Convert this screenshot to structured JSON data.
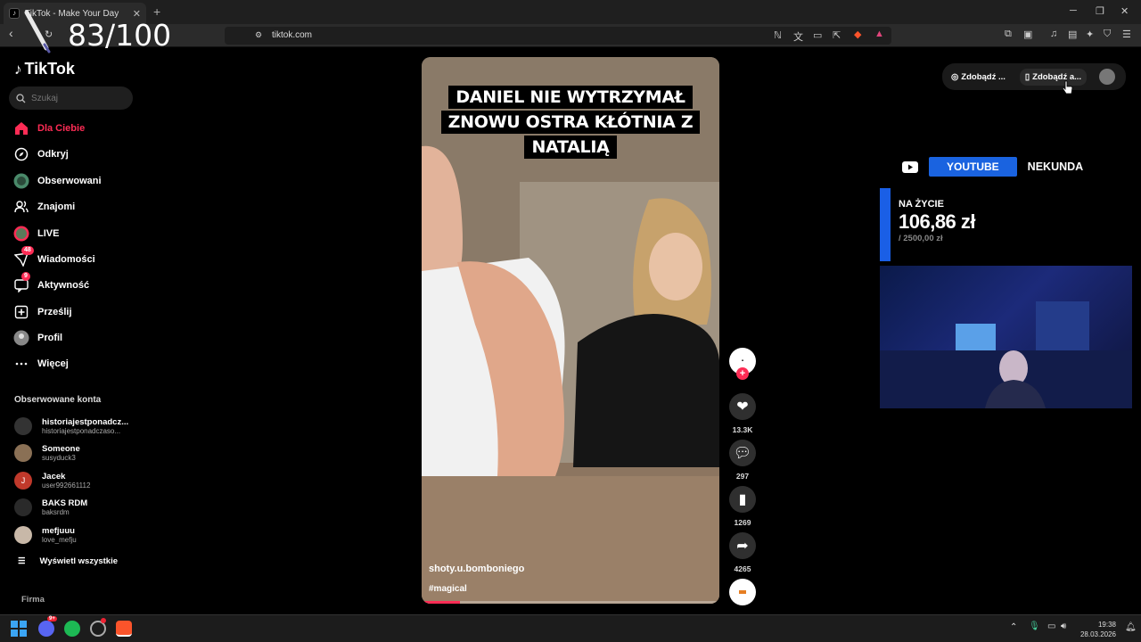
{
  "browser": {
    "tab_title": "TikTok - Make Your Day",
    "url": "tiktok.com"
  },
  "overlay_score": "83/100",
  "sidebar": {
    "logo": "TikTok",
    "search_placeholder": "Szukaj",
    "nav": [
      {
        "label": "Dla Ciebie",
        "icon": "home-icon",
        "active": true,
        "badge": ""
      },
      {
        "label": "Odkryj",
        "icon": "compass-icon",
        "active": false,
        "badge": ""
      },
      {
        "label": "Obserwowani",
        "icon": "following-avatar-icon",
        "active": false,
        "badge": ""
      },
      {
        "label": "Znajomi",
        "icon": "friends-icon",
        "active": false,
        "badge": ""
      },
      {
        "label": "LIVE",
        "icon": "live-icon",
        "active": false,
        "badge": ""
      },
      {
        "label": "Wiadomości",
        "icon": "messages-icon",
        "active": false,
        "badge": "48"
      },
      {
        "label": "Aktywność",
        "icon": "activity-icon",
        "active": false,
        "badge": "9"
      },
      {
        "label": "Prześlij",
        "icon": "upload-icon",
        "active": false,
        "badge": ""
      },
      {
        "label": "Profil",
        "icon": "profile-icon",
        "active": false,
        "badge": ""
      },
      {
        "label": "Więcej",
        "icon": "more-icon",
        "active": false,
        "badge": ""
      }
    ],
    "followed_header": "Obserwowane konta",
    "followed": [
      {
        "name": "historiajestponadcz...",
        "handle": "historiajestponadczaso...",
        "color": "#333333"
      },
      {
        "name": "Someone",
        "handle": "susyduck3",
        "color": "#8a7055"
      },
      {
        "name": "Jacek",
        "handle": "user992661112",
        "color": "#c0392b",
        "initial": "J"
      },
      {
        "name": "BAKS RDM",
        "handle": "baksrdm",
        "color": "#2a2a2a"
      },
      {
        "name": "mefjuuu",
        "handle": "love_mefju",
        "color": "#c8b8a8"
      }
    ],
    "show_all": "Wyświetl wszystkie",
    "footer": "Firma"
  },
  "video": {
    "caption_lines": [
      "DANIEL NIE WYTRZYMAŁ",
      "ZNOWU OSTRA KŁÓTNIA Z",
      "NATALIĄ"
    ],
    "author": "shoty.u.bomboniego",
    "hashtag": "#magical",
    "progress": 0.13
  },
  "actions": {
    "likes": "13.3K",
    "comments": "297",
    "saves": "1269",
    "shares": "4265"
  },
  "top_right": {
    "btn1": "Zdobądź ...",
    "btn2": "Zdobądź a..."
  },
  "stream_overlay": {
    "youtube_label": "YOUTUBE",
    "nekunda_label": "NEKUNDA",
    "goal_label": "NA ŻYCIE",
    "goal_amount": "106,86 zł",
    "goal_target": "/ 2500,00 zł"
  },
  "taskbar": {
    "time": "19:38",
    "date": "28.03.2026",
    "discord_badge": "9+"
  },
  "colors": {
    "accent": "#fe2c55",
    "youtube_blue": "#1a63e0"
  }
}
